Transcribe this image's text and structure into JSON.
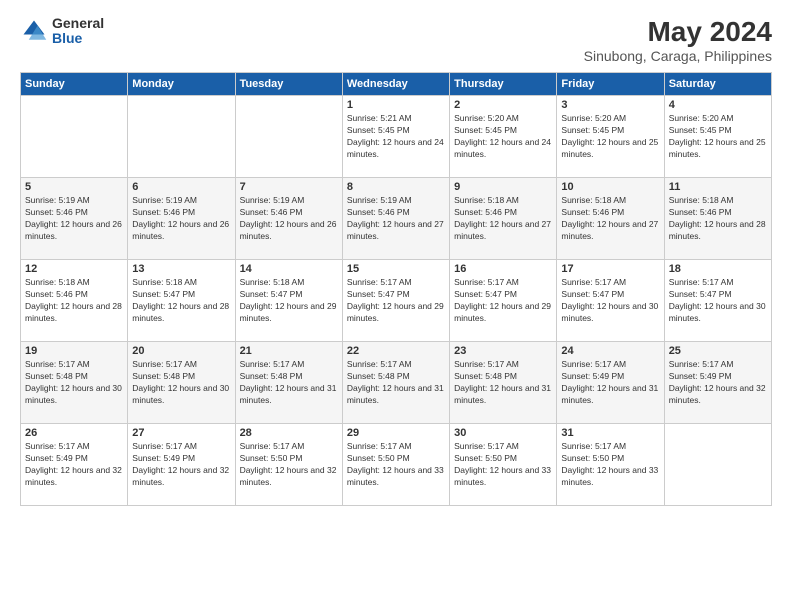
{
  "header": {
    "logo_general": "General",
    "logo_blue": "Blue",
    "main_title": "May 2024",
    "subtitle": "Sinubong, Caraga, Philippines"
  },
  "weekdays": [
    "Sunday",
    "Monday",
    "Tuesday",
    "Wednesday",
    "Thursday",
    "Friday",
    "Saturday"
  ],
  "weeks": [
    [
      {
        "day": "",
        "sunrise": "",
        "sunset": "",
        "daylight": ""
      },
      {
        "day": "",
        "sunrise": "",
        "sunset": "",
        "daylight": ""
      },
      {
        "day": "",
        "sunrise": "",
        "sunset": "",
        "daylight": ""
      },
      {
        "day": "1",
        "sunrise": "Sunrise: 5:21 AM",
        "sunset": "Sunset: 5:45 PM",
        "daylight": "Daylight: 12 hours and 24 minutes."
      },
      {
        "day": "2",
        "sunrise": "Sunrise: 5:20 AM",
        "sunset": "Sunset: 5:45 PM",
        "daylight": "Daylight: 12 hours and 24 minutes."
      },
      {
        "day": "3",
        "sunrise": "Sunrise: 5:20 AM",
        "sunset": "Sunset: 5:45 PM",
        "daylight": "Daylight: 12 hours and 25 minutes."
      },
      {
        "day": "4",
        "sunrise": "Sunrise: 5:20 AM",
        "sunset": "Sunset: 5:45 PM",
        "daylight": "Daylight: 12 hours and 25 minutes."
      }
    ],
    [
      {
        "day": "5",
        "sunrise": "Sunrise: 5:19 AM",
        "sunset": "Sunset: 5:46 PM",
        "daylight": "Daylight: 12 hours and 26 minutes."
      },
      {
        "day": "6",
        "sunrise": "Sunrise: 5:19 AM",
        "sunset": "Sunset: 5:46 PM",
        "daylight": "Daylight: 12 hours and 26 minutes."
      },
      {
        "day": "7",
        "sunrise": "Sunrise: 5:19 AM",
        "sunset": "Sunset: 5:46 PM",
        "daylight": "Daylight: 12 hours and 26 minutes."
      },
      {
        "day": "8",
        "sunrise": "Sunrise: 5:19 AM",
        "sunset": "Sunset: 5:46 PM",
        "daylight": "Daylight: 12 hours and 27 minutes."
      },
      {
        "day": "9",
        "sunrise": "Sunrise: 5:18 AM",
        "sunset": "Sunset: 5:46 PM",
        "daylight": "Daylight: 12 hours and 27 minutes."
      },
      {
        "day": "10",
        "sunrise": "Sunrise: 5:18 AM",
        "sunset": "Sunset: 5:46 PM",
        "daylight": "Daylight: 12 hours and 27 minutes."
      },
      {
        "day": "11",
        "sunrise": "Sunrise: 5:18 AM",
        "sunset": "Sunset: 5:46 PM",
        "daylight": "Daylight: 12 hours and 28 minutes."
      }
    ],
    [
      {
        "day": "12",
        "sunrise": "Sunrise: 5:18 AM",
        "sunset": "Sunset: 5:46 PM",
        "daylight": "Daylight: 12 hours and 28 minutes."
      },
      {
        "day": "13",
        "sunrise": "Sunrise: 5:18 AM",
        "sunset": "Sunset: 5:47 PM",
        "daylight": "Daylight: 12 hours and 28 minutes."
      },
      {
        "day": "14",
        "sunrise": "Sunrise: 5:18 AM",
        "sunset": "Sunset: 5:47 PM",
        "daylight": "Daylight: 12 hours and 29 minutes."
      },
      {
        "day": "15",
        "sunrise": "Sunrise: 5:17 AM",
        "sunset": "Sunset: 5:47 PM",
        "daylight": "Daylight: 12 hours and 29 minutes."
      },
      {
        "day": "16",
        "sunrise": "Sunrise: 5:17 AM",
        "sunset": "Sunset: 5:47 PM",
        "daylight": "Daylight: 12 hours and 29 minutes."
      },
      {
        "day": "17",
        "sunrise": "Sunrise: 5:17 AM",
        "sunset": "Sunset: 5:47 PM",
        "daylight": "Daylight: 12 hours and 30 minutes."
      },
      {
        "day": "18",
        "sunrise": "Sunrise: 5:17 AM",
        "sunset": "Sunset: 5:47 PM",
        "daylight": "Daylight: 12 hours and 30 minutes."
      }
    ],
    [
      {
        "day": "19",
        "sunrise": "Sunrise: 5:17 AM",
        "sunset": "Sunset: 5:48 PM",
        "daylight": "Daylight: 12 hours and 30 minutes."
      },
      {
        "day": "20",
        "sunrise": "Sunrise: 5:17 AM",
        "sunset": "Sunset: 5:48 PM",
        "daylight": "Daylight: 12 hours and 30 minutes."
      },
      {
        "day": "21",
        "sunrise": "Sunrise: 5:17 AM",
        "sunset": "Sunset: 5:48 PM",
        "daylight": "Daylight: 12 hours and 31 minutes."
      },
      {
        "day": "22",
        "sunrise": "Sunrise: 5:17 AM",
        "sunset": "Sunset: 5:48 PM",
        "daylight": "Daylight: 12 hours and 31 minutes."
      },
      {
        "day": "23",
        "sunrise": "Sunrise: 5:17 AM",
        "sunset": "Sunset: 5:48 PM",
        "daylight": "Daylight: 12 hours and 31 minutes."
      },
      {
        "day": "24",
        "sunrise": "Sunrise: 5:17 AM",
        "sunset": "Sunset: 5:49 PM",
        "daylight": "Daylight: 12 hours and 31 minutes."
      },
      {
        "day": "25",
        "sunrise": "Sunrise: 5:17 AM",
        "sunset": "Sunset: 5:49 PM",
        "daylight": "Daylight: 12 hours and 32 minutes."
      }
    ],
    [
      {
        "day": "26",
        "sunrise": "Sunrise: 5:17 AM",
        "sunset": "Sunset: 5:49 PM",
        "daylight": "Daylight: 12 hours and 32 minutes."
      },
      {
        "day": "27",
        "sunrise": "Sunrise: 5:17 AM",
        "sunset": "Sunset: 5:49 PM",
        "daylight": "Daylight: 12 hours and 32 minutes."
      },
      {
        "day": "28",
        "sunrise": "Sunrise: 5:17 AM",
        "sunset": "Sunset: 5:50 PM",
        "daylight": "Daylight: 12 hours and 32 minutes."
      },
      {
        "day": "29",
        "sunrise": "Sunrise: 5:17 AM",
        "sunset": "Sunset: 5:50 PM",
        "daylight": "Daylight: 12 hours and 33 minutes."
      },
      {
        "day": "30",
        "sunrise": "Sunrise: 5:17 AM",
        "sunset": "Sunset: 5:50 PM",
        "daylight": "Daylight: 12 hours and 33 minutes."
      },
      {
        "day": "31",
        "sunrise": "Sunrise: 5:17 AM",
        "sunset": "Sunset: 5:50 PM",
        "daylight": "Daylight: 12 hours and 33 minutes."
      },
      {
        "day": "",
        "sunrise": "",
        "sunset": "",
        "daylight": ""
      }
    ]
  ]
}
